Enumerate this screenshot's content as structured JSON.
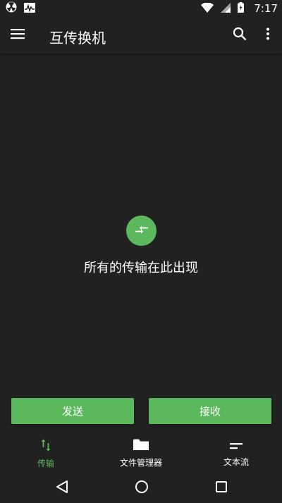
{
  "status_bar": {
    "time": "7:17",
    "left_icons": [
      "radiation-icon",
      "activity-icon"
    ],
    "right_icons": [
      "wifi-icon",
      "signal-icon",
      "battery-icon"
    ]
  },
  "app_bar": {
    "title": "互传换机",
    "icons": [
      "menu-icon",
      "search-icon",
      "more-vert-icon"
    ]
  },
  "empty_state": {
    "icon": "transfer-arrows-icon",
    "message": "所有的传输在此出现"
  },
  "actions": {
    "send_label": "发送",
    "receive_label": "接收"
  },
  "bottom_nav": {
    "items": [
      {
        "label": "传输",
        "icon": "swap-vert-icon",
        "active": true
      },
      {
        "label": "文件管理器",
        "icon": "folder-icon",
        "active": false
      },
      {
        "label": "文本流",
        "icon": "short-text-icon",
        "active": false
      }
    ]
  },
  "system_nav": {
    "icons": [
      "back-icon",
      "home-icon",
      "recents-icon"
    ]
  },
  "colors": {
    "background": "#212121",
    "accent": "#5cb85c",
    "text": "#ffffff"
  }
}
